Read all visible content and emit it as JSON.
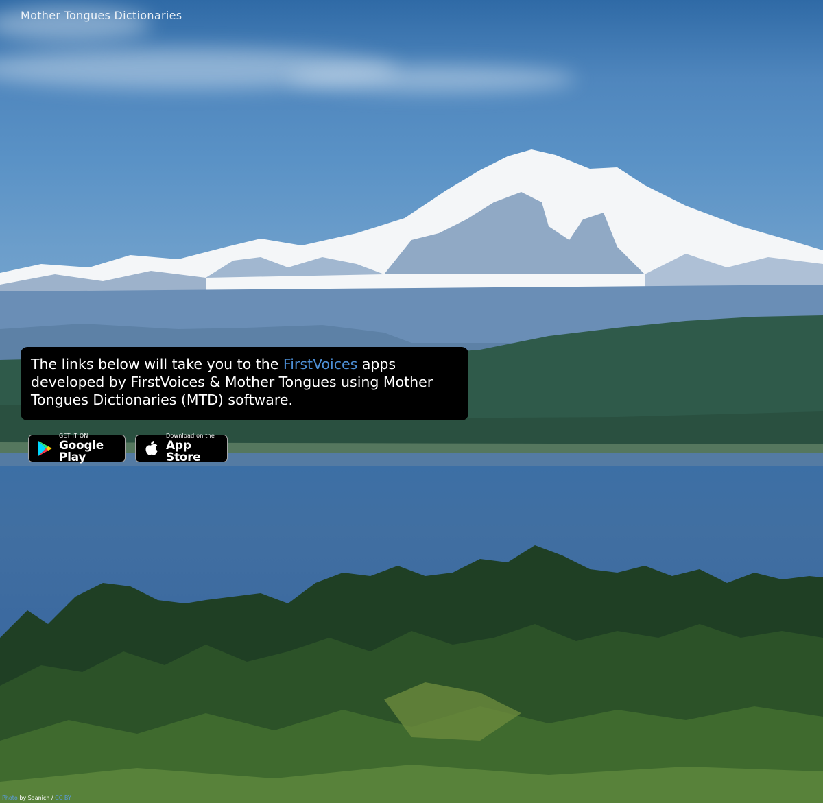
{
  "header": {
    "site_title": "Mother Tongues Dictionaries"
  },
  "intro": {
    "text_before_link": "The links below will take you to the ",
    "link_text": "FirstVoices",
    "text_after_link": " apps developed by FirstVoices & Mother Tongues using Mother Tongues Dictionaries (MTD) software."
  },
  "badges": {
    "google_play": {
      "small": "GET IT ON",
      "big": "Google Play",
      "icon": "google-play-icon"
    },
    "app_store": {
      "small": "Download on the",
      "big": "App Store",
      "icon": "apple-icon"
    }
  },
  "credit": {
    "photo_link": "Photo",
    "by_text": " by Saanich / ",
    "license_link": "CC BY"
  },
  "colors": {
    "link": "#4d8fd6",
    "box_bg": "#000000",
    "badge_border": "#a6a6a6"
  }
}
